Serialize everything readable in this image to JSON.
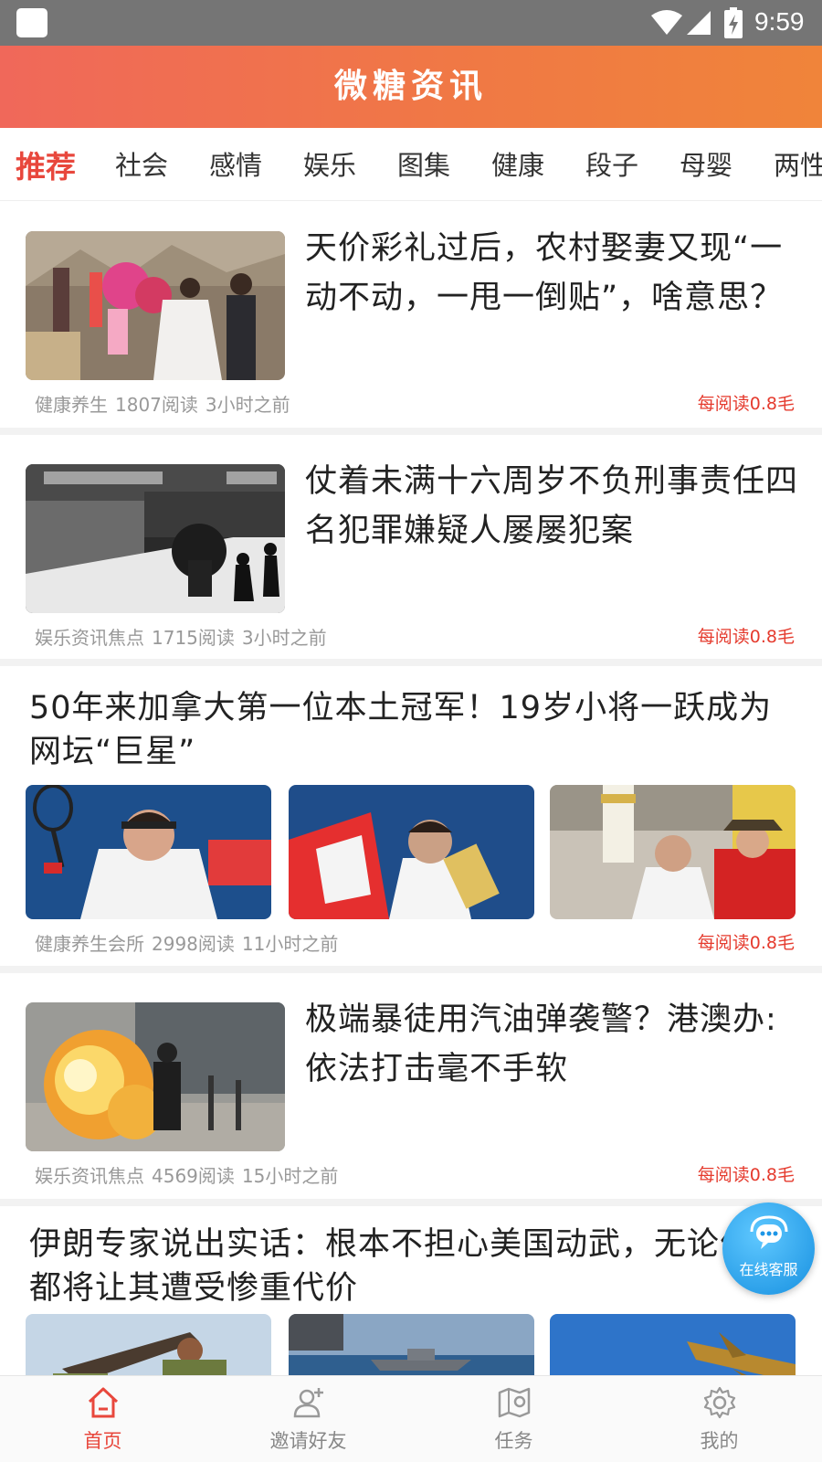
{
  "status_bar": {
    "time": "9:59"
  },
  "header": {
    "title": "微糖资讯"
  },
  "tabs": [
    {
      "label": "推荐",
      "active": true
    },
    {
      "label": "社会"
    },
    {
      "label": "感情"
    },
    {
      "label": "娱乐"
    },
    {
      "label": "图集"
    },
    {
      "label": "健康"
    },
    {
      "label": "段子"
    },
    {
      "label": "母婴"
    },
    {
      "label": "两性"
    }
  ],
  "articles": [
    {
      "title": "天价彩礼过后，农村娶妻又现“一动不动，一甩一倒贴”，啥意思？",
      "source": "健康养生",
      "reads": "1807阅读",
      "time": "3小时之前",
      "reward": "每阅读0.8毛",
      "image": "wedding-photo"
    },
    {
      "title": "仗着未满十六周岁不负刑事责任四名犯罪嫌疑人屡屡犯案",
      "source": "娱乐资讯焦点",
      "reads": "1715阅读",
      "time": "3小时之前",
      "reward": "每阅读0.8毛",
      "image": "surveillance-photo"
    },
    {
      "title": "50年来加拿大第一位本土冠军！19岁小将一跃成为网坛“巨星”",
      "source": "健康养生会所",
      "reads": "2998阅读",
      "time": "11小时之前",
      "reward": "每阅读0.8毛",
      "images": [
        "tennis-photo-1",
        "tennis-photo-2",
        "tennis-photo-3"
      ]
    },
    {
      "title": "极端暴徒用汽油弹袭警？港澳办:依法打击毫不手软",
      "source": "娱乐资讯焦点",
      "reads": "4569阅读",
      "time": "15小时之前",
      "reward": "每阅读0.8毛",
      "image": "fire-photo"
    },
    {
      "title": "伊朗专家说出实话：根本不担心美国动武，无论何时都将让其遭受惨重代价",
      "images": [
        "soldier-photo",
        "ship-photo",
        "jet-photo"
      ]
    }
  ],
  "chat_button": {
    "label": "在线客服"
  },
  "bottom_nav": [
    {
      "label": "首页",
      "icon": "home-icon",
      "active": true
    },
    {
      "label": "邀请好友",
      "icon": "invite-friend-icon"
    },
    {
      "label": "任务",
      "icon": "task-map-icon"
    },
    {
      "label": "我的",
      "icon": "settings-gear-icon"
    }
  ],
  "colors": {
    "accent": "#e8473c",
    "header_start": "#f0685a",
    "header_end": "#f0843a",
    "reward": "#e53b2e",
    "chat": "#1e96e6"
  }
}
